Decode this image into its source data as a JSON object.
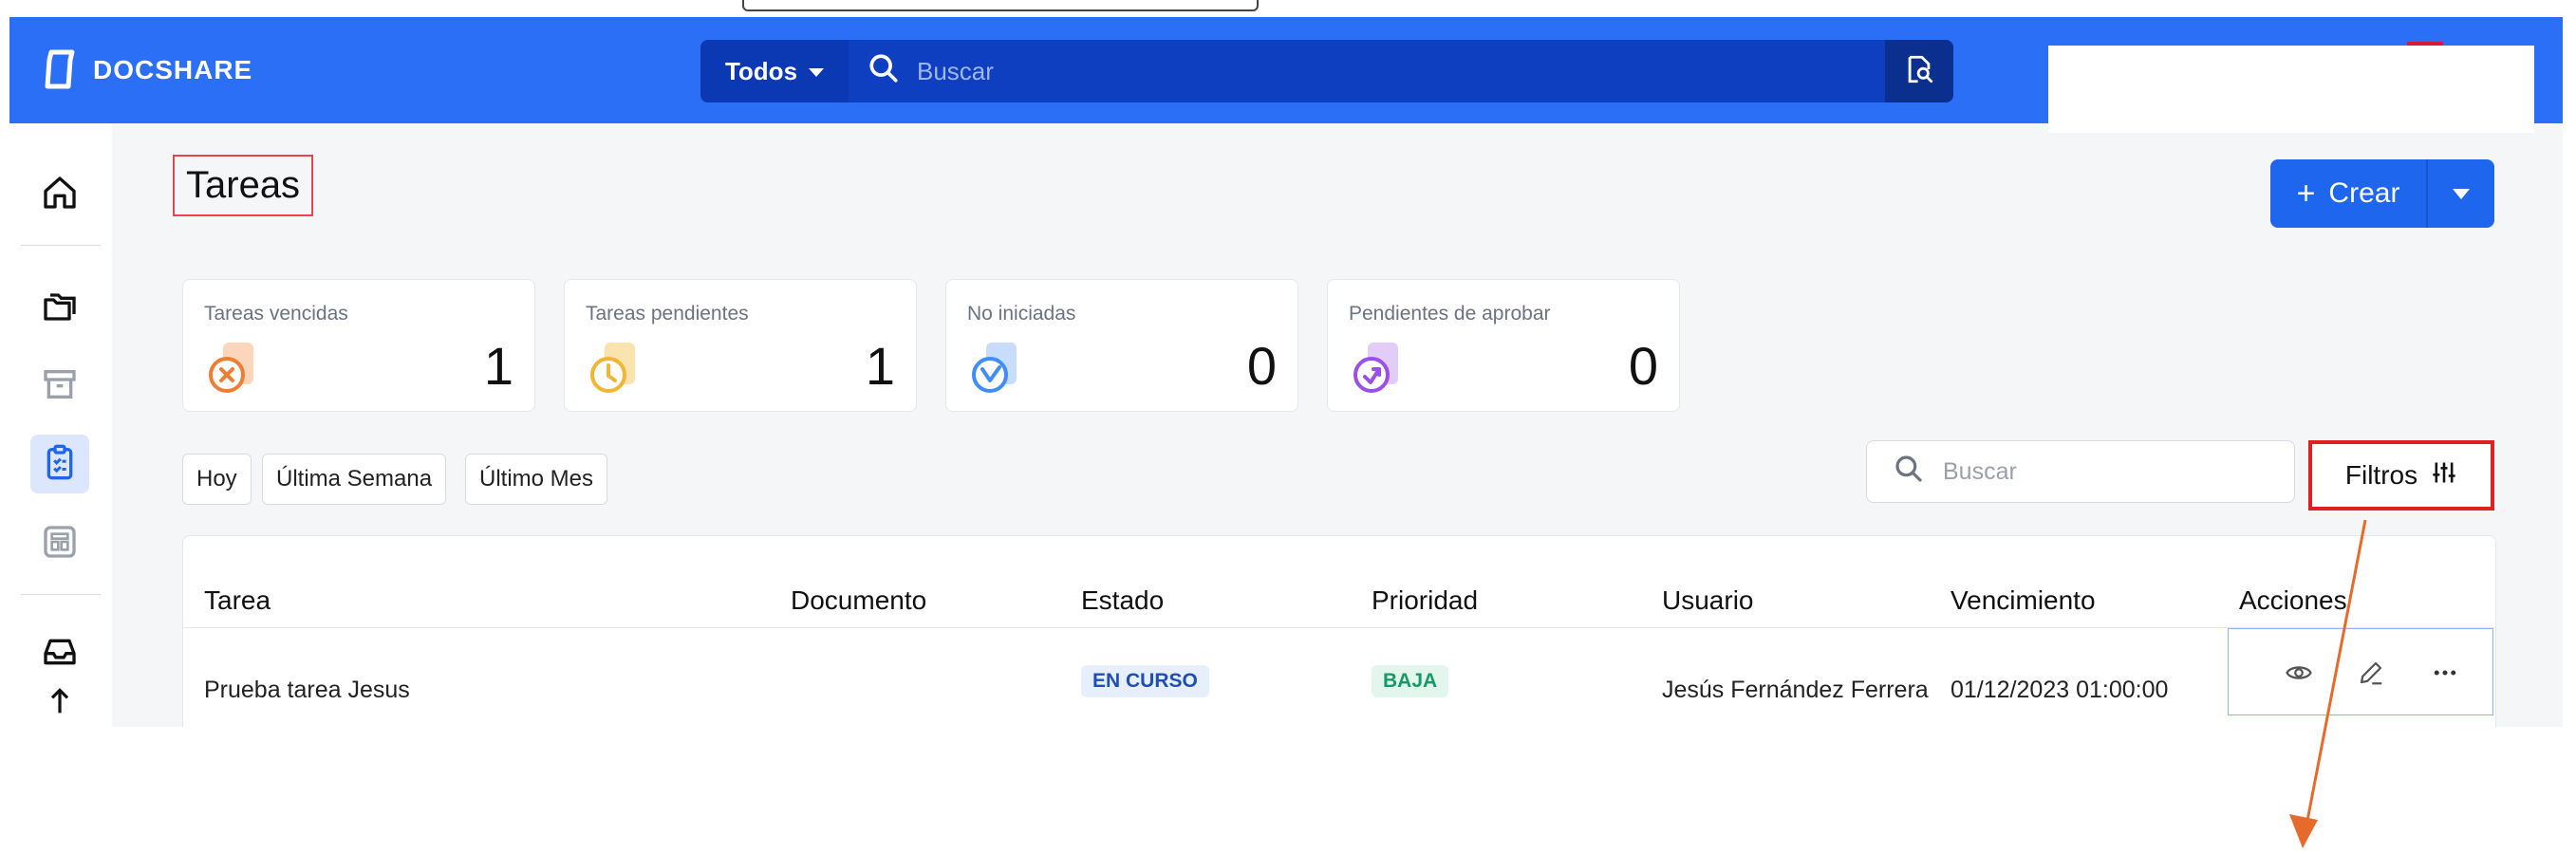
{
  "app": {
    "brand": "DOCSHARE",
    "colors": {
      "primary": "#2b6ff7",
      "danger_outline": "#e02020",
      "annotation": "#e66a2c"
    }
  },
  "topbar": {
    "scope_label": "Todos",
    "search_placeholder": "Buscar"
  },
  "sidebar": {
    "items": [
      {
        "icon": "home-icon",
        "active": false
      },
      {
        "icon": "folders-icon",
        "active": false
      },
      {
        "icon": "archive-icon",
        "active": false
      },
      {
        "icon": "tasks-clipboard-icon",
        "active": true
      },
      {
        "icon": "layout-icon",
        "active": false
      },
      {
        "icon": "inbox-icon",
        "active": false
      },
      {
        "icon": "upload-icon",
        "active": false
      }
    ]
  },
  "page": {
    "title": "Tareas",
    "create_label": "Crear"
  },
  "stats": [
    {
      "label": "Tareas vencidas",
      "value": "1",
      "icon": "overdue-task-icon",
      "color": "#ef7d33"
    },
    {
      "label": "Tareas pendientes",
      "value": "1",
      "icon": "pending-clock-icon",
      "color": "#f2b535"
    },
    {
      "label": "No iniciadas",
      "value": "0",
      "icon": "not-started-icon",
      "color": "#3f8ef5"
    },
    {
      "label": "Pendientes de aprobar",
      "value": "0",
      "icon": "approval-icon",
      "color": "#9a4fe6"
    }
  ],
  "date_filters": [
    "Hoy",
    "Última Semana",
    "Último Mes"
  ],
  "list_search": {
    "placeholder": "Buscar"
  },
  "filters_label": "Filtros",
  "table": {
    "columns": [
      "Tarea",
      "Documento",
      "Estado",
      "Prioridad",
      "Usuario",
      "Vencimiento",
      "Acciones"
    ],
    "rows": [
      {
        "tarea": "Prueba tarea Jesus",
        "documento": "",
        "estado": "EN CURSO",
        "prioridad": "BAJA",
        "usuario": "Jesús Fernández Ferrera",
        "vencimiento": "01/12/2023 01:00:00"
      }
    ]
  }
}
